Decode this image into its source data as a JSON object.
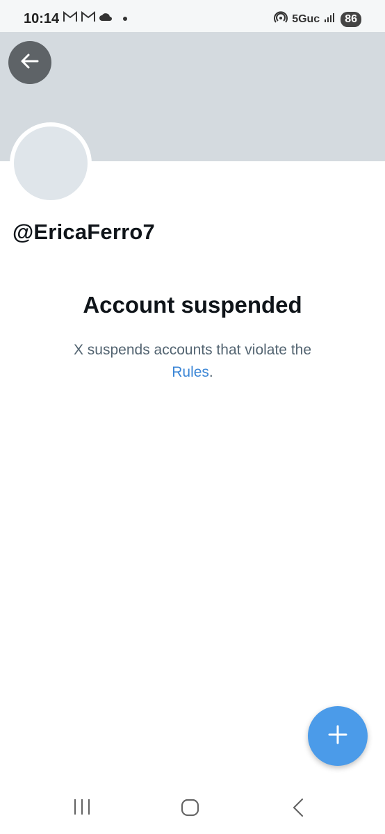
{
  "status_bar": {
    "time": "10:14",
    "network": "5Guc",
    "battery": "86",
    "icons": [
      "gmail-icon",
      "gmail-icon",
      "cloud-icon",
      "dot-icon",
      "hotspot-icon",
      "signal-icon"
    ]
  },
  "profile": {
    "handle": "@EricaFerro7"
  },
  "suspension": {
    "title": "Account suspended",
    "desc_before": "X suspends accounts that violate the",
    "link_text": "Rules",
    "desc_after": "."
  },
  "colors": {
    "banner": "#d4dadf",
    "link": "#3b86d6",
    "fab": "#4b9be9"
  }
}
